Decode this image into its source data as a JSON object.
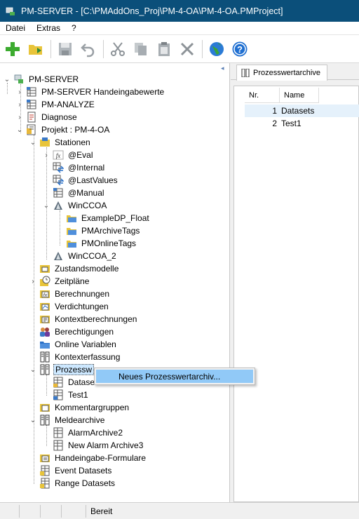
{
  "window": {
    "title": "PM-SERVER - [C:\\PMAddOns_Proj\\PM-4-OA\\PM-4-OA.PMProject]"
  },
  "menubar": {
    "items": [
      "Datei",
      "Extras",
      "?"
    ]
  },
  "toolbar": {
    "buttons": [
      "add-icon",
      "open-project-icon",
      "save-icon",
      "undo-icon",
      "cut-icon",
      "copy-icon",
      "paste-icon",
      "delete-icon",
      "globe-icon",
      "help-icon"
    ]
  },
  "tree": {
    "nodes": [
      {
        "label": "PM-SERVER",
        "icon": "server-icon"
      },
      {
        "label": "PM-SERVER Handeingabewerte",
        "icon": "grid-icon"
      },
      {
        "label": "PM-ANALYZE",
        "icon": "grid-icon"
      },
      {
        "label": "Diagnose",
        "icon": "diagnose-icon"
      },
      {
        "label": "Projekt : PM-4-OA",
        "icon": "project-icon"
      },
      {
        "label": "Stationen",
        "icon": "stations-icon"
      },
      {
        "label": "@Eval",
        "icon": "function-icon"
      },
      {
        "label": "@Internal",
        "icon": "transfer-icon"
      },
      {
        "label": "@LastValues",
        "icon": "transfer-icon"
      },
      {
        "label": "@Manual",
        "icon": "grid-icon"
      },
      {
        "label": "WinCCOA",
        "icon": "wincc-icon"
      },
      {
        "label": "ExampleDP_Float",
        "icon": "folder-icon"
      },
      {
        "label": "PMArchiveTags",
        "icon": "folder-icon"
      },
      {
        "label": "PMOnlineTags",
        "icon": "folder-icon"
      },
      {
        "label": "WinCCOA_2",
        "icon": "wincc-icon"
      },
      {
        "label": "Zustandsmodelle",
        "icon": "state-model-icon"
      },
      {
        "label": "Zeitpläne",
        "icon": "schedule-icon"
      },
      {
        "label": "Berechnungen",
        "icon": "calculation-icon"
      },
      {
        "label": "Verdichtungen",
        "icon": "compression-icon"
      },
      {
        "label": "Kontextberechnungen",
        "icon": "context-calc-icon"
      },
      {
        "label": "Berechtigungen",
        "icon": "users-icon"
      },
      {
        "label": "Online Variablen",
        "icon": "online-variables-icon"
      },
      {
        "label": "Kontexterfassung",
        "icon": "context-capture-icon"
      },
      {
        "label": "Prozessw",
        "icon": "archive-icon"
      },
      {
        "label": "Datase",
        "icon": "archive-item-icon"
      },
      {
        "label": "Test1",
        "icon": "archive-item-icon"
      },
      {
        "label": "Kommentargruppen",
        "icon": "comment-icon"
      },
      {
        "label": "Meldearchive",
        "icon": "archive-icon"
      },
      {
        "label": "AlarmArchive2",
        "icon": "alarm-archive-icon"
      },
      {
        "label": "New Alarm Archive3",
        "icon": "alarm-archive-icon"
      },
      {
        "label": "Handeingabe-Formulare",
        "icon": "form-icon"
      },
      {
        "label": "Event Datasets",
        "icon": "dataset-icon"
      },
      {
        "label": "Range Datasets",
        "icon": "dataset-icon"
      }
    ]
  },
  "context_menu": {
    "items": [
      "Neues Prozesswertarchiv..."
    ]
  },
  "right_pane": {
    "tab_label": "Prozesswertarchive",
    "columns": [
      "Nr.",
      "Name"
    ],
    "rows": [
      {
        "nr": "1",
        "name": "Datasets"
      },
      {
        "nr": "2",
        "name": "Test1"
      }
    ]
  },
  "statusbar": {
    "text": "Bereit"
  },
  "colors": {
    "titlebar": "#0b4f7a",
    "selection": "#cde8ff",
    "context_highlight": "#91c9f7"
  }
}
